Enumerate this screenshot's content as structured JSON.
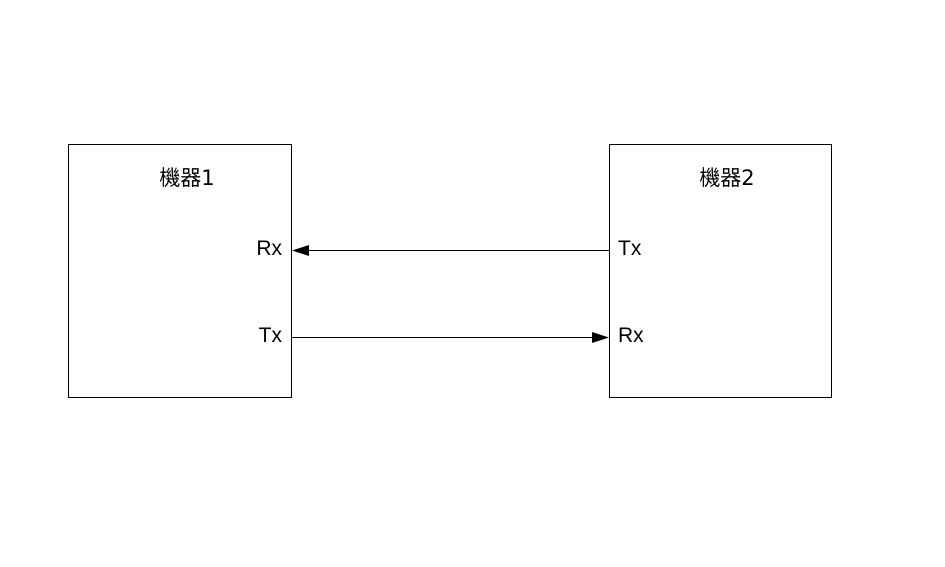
{
  "device1": {
    "title": "機器1",
    "ports": {
      "rx": "Rx",
      "tx": "Tx"
    }
  },
  "device2": {
    "title": "機器2",
    "ports": {
      "tx": "Tx",
      "rx": "Rx"
    }
  },
  "connections": [
    {
      "from": "device2.tx",
      "to": "device1.rx"
    },
    {
      "from": "device1.tx",
      "to": "device2.rx"
    }
  ],
  "colors": {
    "stroke": "#000000",
    "background": "#ffffff"
  }
}
